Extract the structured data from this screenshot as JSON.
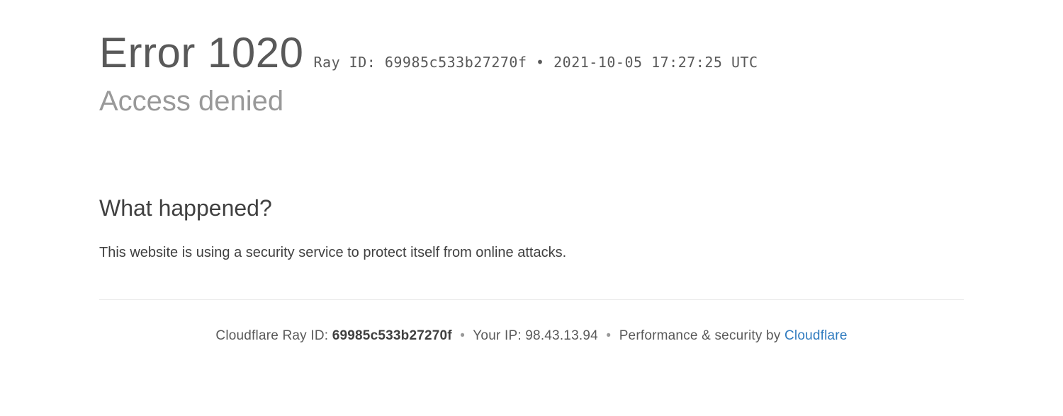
{
  "header": {
    "error_title": "Error 1020",
    "ray_label": "Ray ID:",
    "ray_id": "69985c533b27270f",
    "bullet": "•",
    "timestamp": "2021-10-05 17:27:25 UTC",
    "subtitle": "Access denied"
  },
  "section": {
    "heading": "What happened?",
    "body": "This website is using a security service to protect itself from online attacks."
  },
  "footer": {
    "ray_label": "Cloudflare Ray ID:",
    "ray_id": "69985c533b27270f",
    "sep": "•",
    "ip_label": "Your IP:",
    "ip_value": "98.43.13.94",
    "perf_label": "Performance & security by",
    "brand": "Cloudflare"
  }
}
